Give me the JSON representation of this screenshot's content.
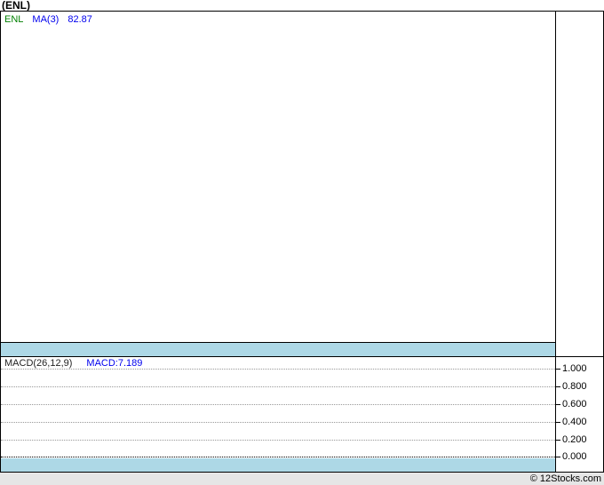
{
  "title": "(ENL)",
  "main_panel": {
    "legend": {
      "symbol": "ENL",
      "ma_label": "MA(3)",
      "ma_value": "82.87"
    }
  },
  "macd_panel": {
    "legend": {
      "indicator": "MACD(26,12,9)",
      "value_label": "MACD:7.189"
    },
    "axis_ticks": [
      "1.000",
      "0.800",
      "0.600",
      "0.400",
      "0.200",
      "0.000"
    ]
  },
  "footer": {
    "copyright": "© 12Stocks.com"
  },
  "colors": {
    "symbol_green": "#008000",
    "indicator_blue": "#0000ee",
    "separator_blue": "#add8e6",
    "gridline_gray": "#999999",
    "border_black": "#000000",
    "footer_gray": "#e6e6e6"
  },
  "chart_data": [
    {
      "type": "line",
      "panel": "price",
      "title": "(ENL)",
      "series": [
        {
          "name": "ENL",
          "values": []
        },
        {
          "name": "MA(3)",
          "last_value": 82.87,
          "values": []
        }
      ],
      "xlabel": "",
      "ylabel": "",
      "grid": false,
      "note_visible_points": 0
    },
    {
      "type": "line",
      "panel": "MACD",
      "series": [
        {
          "name": "MACD(26,12,9)",
          "last_value": 7.189,
          "values": []
        }
      ],
      "ytick_values": [
        1.0,
        0.8,
        0.6,
        0.4,
        0.2,
        0.0
      ],
      "ytick_labels": [
        "1.000",
        "0.800",
        "0.600",
        "0.400",
        "0.200",
        "0.000"
      ],
      "ylim": [
        0.0,
        1.15
      ],
      "grid": true,
      "legend_position": "top-left",
      "note_visible_points": 0
    }
  ]
}
